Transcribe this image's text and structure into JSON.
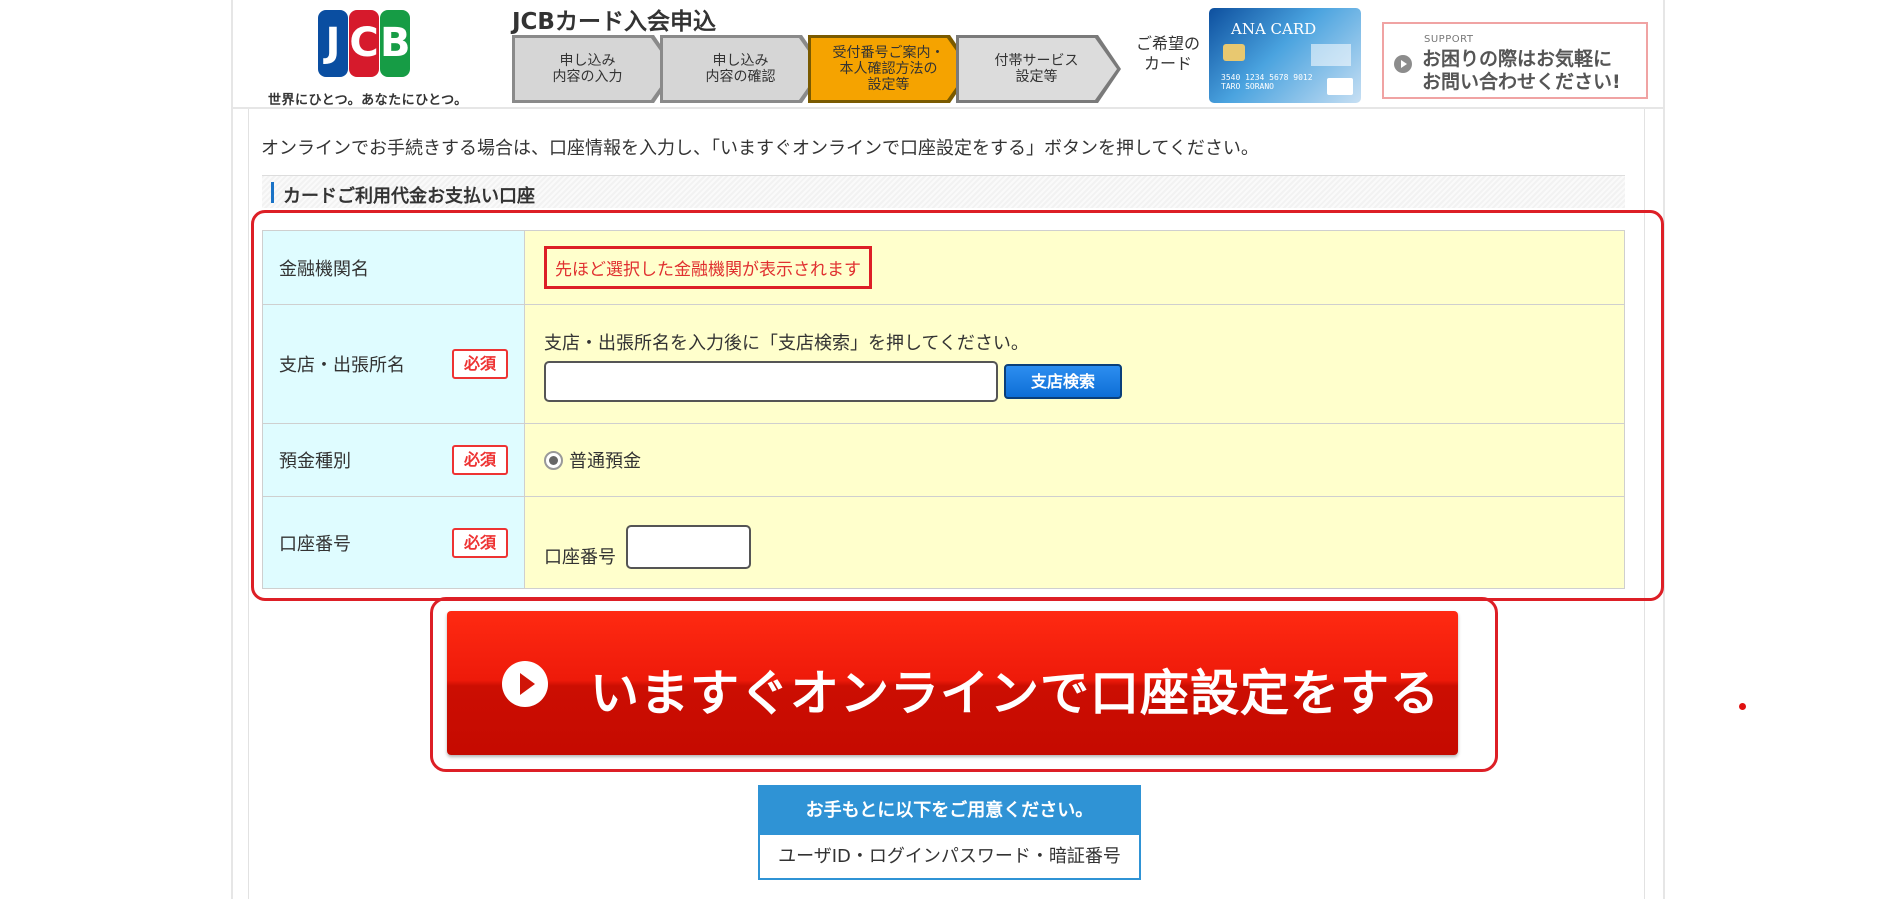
{
  "header": {
    "logo_letters": [
      "J",
      "C",
      "B"
    ],
    "tagline": "世界にひとつ。あなたにひとつ。",
    "app_title": "JCBカード入会申込",
    "steps": [
      {
        "line1": "申し込み",
        "line2": "内容の入力",
        "line3": "",
        "state": "done"
      },
      {
        "line1": "申し込み",
        "line2": "内容の確認",
        "line3": "",
        "state": "done"
      },
      {
        "line1": "受付番号ご案内・",
        "line2": "本人確認方法の",
        "line3": "設定等",
        "state": "current"
      },
      {
        "line1": "付帯サービス",
        "line2": "設定等",
        "line3": "",
        "state": "upcoming"
      }
    ],
    "wish_label_line1": "ご希望の",
    "wish_label_line2": "カード",
    "card": {
      "name": "ANA CARD",
      "number": "3540 1234 5678 9012",
      "holder": "TARO SORANO"
    },
    "support": {
      "label": "SUPPORT",
      "line1": "お困りの際はお気軽に",
      "line2": "お問い合わせください!"
    }
  },
  "intro_text": "オンラインでお手続きする場合は、口座情報を入力し、「いますぐオンラインで口座設定をする」ボタンを押してください。",
  "section_title": "カードご利用代金お支払い口座",
  "required_badge": "必須",
  "form": {
    "bank": {
      "label": "金融機関名",
      "notice": "先ほど選択した金融機関が表示されます"
    },
    "branch": {
      "label": "支店・出張所名",
      "hint": "支店・出張所名を入力後に「支店検索」を押してください。",
      "value": "",
      "search_button": "支店検索"
    },
    "deposit": {
      "label": "預金種別",
      "option": "普通預金",
      "selected": true
    },
    "account": {
      "label": "口座番号",
      "inline_label": "口座番号",
      "value": ""
    }
  },
  "cta_label": "いますぐオンラインで口座設定をする",
  "prep": {
    "head": "お手もとに以下をご用意ください。",
    "body": "ユーザID・ログインパスワード・暗証番号"
  },
  "colors": {
    "accent_red": "#dd1f26",
    "step_current": "#f5a300",
    "label_bg": "#dffcff",
    "value_bg": "#ffffcc",
    "button_blue": "#2f93d5"
  }
}
